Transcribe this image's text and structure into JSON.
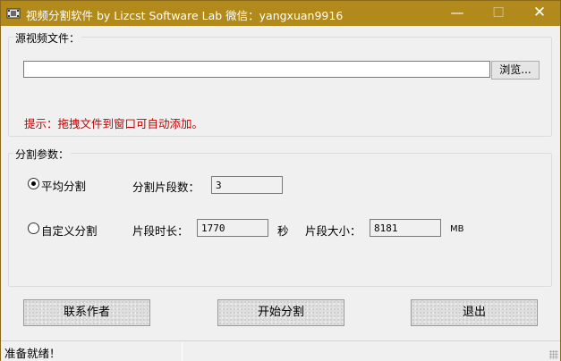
{
  "window": {
    "title": "视频分割软件  by Lizcst Software Lab  微信：yangxuan9916",
    "minimize_glyph": "—",
    "maximize_glyph": "☐",
    "close_glyph": "✕",
    "titlebar_color": "#b2891b"
  },
  "source": {
    "legend": "源视频文件：",
    "path_value": "",
    "browse_label": "浏览...",
    "hint": "提示：拖拽文件到窗口可自动添加。",
    "hint_color": "#c00000"
  },
  "params": {
    "legend": "分割参数：",
    "average": {
      "label": "平均分割",
      "checked": true,
      "segment_count_label": "分割片段数：",
      "segment_count_value": "3"
    },
    "custom": {
      "label": "自定义分割",
      "checked": false,
      "duration_label": "片段时长：",
      "duration_value": "1770",
      "duration_unit": "秒",
      "size_label": "片段大小：",
      "size_value": "8181",
      "size_unit": "MB"
    }
  },
  "actions": {
    "contact_label": "联系作者",
    "start_label": "开始分割",
    "exit_label": "退出"
  },
  "status": {
    "text": "准备就绪！"
  }
}
